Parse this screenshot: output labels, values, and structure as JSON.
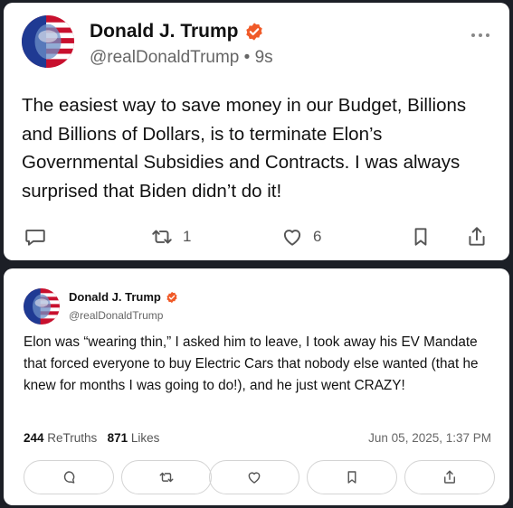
{
  "post": {
    "author_name": "Donald J. Trump",
    "handle": "@realDonaldTrump",
    "time": "9s",
    "text": "The easiest way to save money in our Budget, Billions and Billions of Dollars, is to terminate Elon’s Governmental Subsidies and Contracts. I was always surprised that Biden didn’t do it!",
    "retruths": "1",
    "likes": "6",
    "icons": [
      "comment-icon",
      "retruth-icon",
      "heart-icon",
      "bookmark-icon",
      "share-icon",
      "more-icon"
    ]
  },
  "quoted": {
    "author_name": "Donald J. Trump",
    "handle": "@realDonaldTrump",
    "text": "Elon was “wearing thin,” I asked him to leave, I took away his EV Mandate that forced everyone to buy Electric Cars that nobody else wanted (that he knew for months I was going to do!), and he just went CRAZY!",
    "retruths_count": "244",
    "retruths_label": "ReTruths",
    "likes_count": "871",
    "likes_label": "Likes",
    "date": "Jun 05, 2025, 1:37 PM"
  },
  "colors": {
    "verified_badge": "#f05a28",
    "background": "#1c1f26",
    "card": "#ffffff"
  }
}
